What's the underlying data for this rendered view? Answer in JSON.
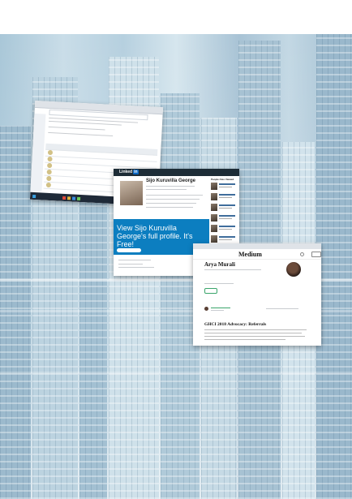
{
  "background": {
    "description_colors": {
      "sky": "#c9dde8",
      "steel": "#9fbccf"
    }
  },
  "cards": {
    "table_page": {
      "icons": [
        "browser-icon",
        "taskbar-icon"
      ]
    },
    "linkedin": {
      "logo": "Linked",
      "logo_in": "in",
      "name": "Sijo Kuruvilla George",
      "banner_text": "View Sijo Kuruvilla George's full profile. It's Free!",
      "side_title": "People Also Viewed",
      "brand_color": "#0a66c2"
    },
    "medium": {
      "logo": "Medium",
      "author_name": "Arya Murali",
      "article_title": "GHCI 2018 Advocacy: Referrals",
      "accent": "#3aa56b"
    }
  }
}
